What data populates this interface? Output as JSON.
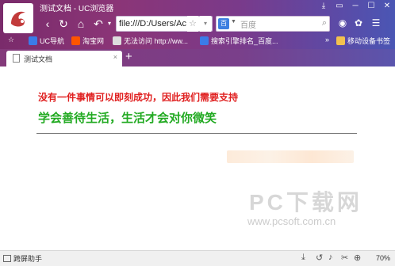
{
  "window": {
    "title": "测试文档 - UC浏览器",
    "controls": [
      "⤓",
      "▭",
      "─",
      "☐",
      "✕"
    ]
  },
  "nav": {
    "back": "‹",
    "forward": "›",
    "reload": "↻",
    "home": "⌂",
    "undo": "↶"
  },
  "address": {
    "value": "file:///D:/Users/Ac",
    "star": "☆"
  },
  "search": {
    "engine": "百",
    "placeholder": "百度",
    "icon": "🔍"
  },
  "bookmarks": {
    "star": "☆",
    "items": [
      {
        "label": "UC导航",
        "color": "#3b7be8"
      },
      {
        "label": "淘宝网",
        "color": "#ff5500"
      },
      {
        "label": "无法访问 http://ww...",
        "color": "#cccccc"
      },
      {
        "label": "搜索引擎排名_百度...",
        "color": "#3b7be8"
      }
    ],
    "more": "»",
    "mobile": "移动设备书签"
  },
  "tabs": [
    {
      "label": "测试文档",
      "close": "×"
    }
  ],
  "newtab": "+",
  "content": {
    "line1": "没有一件事情可以即刻成功，因此我们需要支持",
    "line2": "学会善待生活，生活才会对你微笑",
    "line1_color": "#e02020",
    "line2_color": "#22aa22"
  },
  "watermark": {
    "big": "PC下载网",
    "small": "www.pcsoft.com.cn"
  },
  "status": {
    "left": "跨屏助手",
    "zoom": "70%"
  }
}
